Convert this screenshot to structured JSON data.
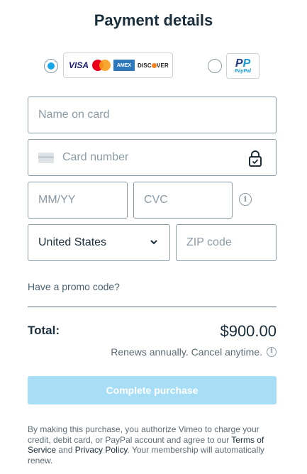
{
  "header": {
    "title": "Payment details"
  },
  "payment_methods": {
    "card": {
      "selected": true,
      "logos": {
        "visa": "VISA",
        "amex": "AMEX",
        "discover": "DISC",
        "discover_tail": "VER"
      }
    },
    "paypal": {
      "selected": false,
      "logo_text_a": "Pay",
      "logo_text_b": "Pal"
    }
  },
  "form": {
    "name_on_card": {
      "placeholder": "Name on card",
      "value": ""
    },
    "card_number": {
      "placeholder": "Card number",
      "value": ""
    },
    "expiry": {
      "placeholder": "MM/YY",
      "value": ""
    },
    "cvc": {
      "placeholder": "CVC",
      "value": ""
    },
    "country": {
      "value": "United States"
    },
    "zip": {
      "placeholder": "ZIP code",
      "value": ""
    },
    "info_glyph": "i"
  },
  "promo": {
    "label": "Have a promo code?"
  },
  "summary": {
    "total_label": "Total:",
    "total_amount": "$900.00",
    "renewal_note": "Renews annually. Cancel anytime."
  },
  "actions": {
    "complete_label": "Complete purchase"
  },
  "legal": {
    "text_1": "By making this purchase, you authorize Vimeo to charge your credit, debit card, or PayPal account and agree to our ",
    "terms_link": "Terms of Service",
    "text_and": " and ",
    "privacy_link": "Privacy Policy",
    "text_2": ". Your membership will automatically renew."
  },
  "colors": {
    "accent": "#17a6e8",
    "button_disabled": "#a7def6",
    "border": "#8a9aa5",
    "text": "#1a2e3b"
  }
}
